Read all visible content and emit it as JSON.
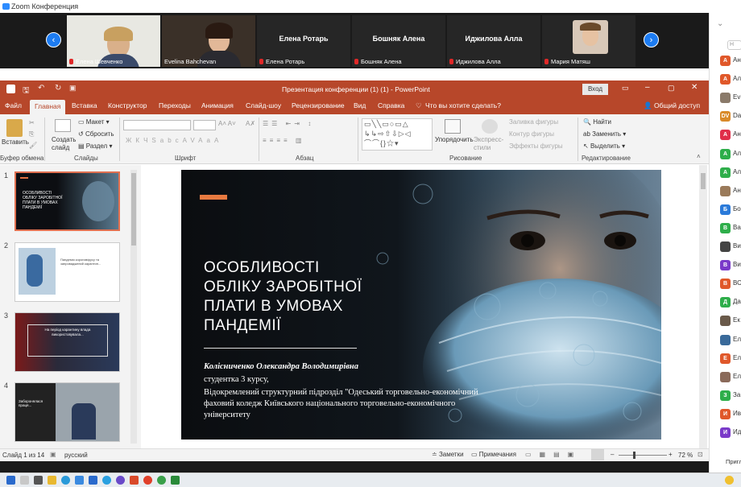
{
  "zoom": {
    "window_title": "Zoom Конференция",
    "participants_tiles": [
      {
        "name": "Елена Шевченко",
        "muted": true,
        "video": true
      },
      {
        "name": "Evelina Bahchevan",
        "muted": false,
        "video": true
      },
      {
        "name": "Елена Ротарь",
        "muted": true,
        "video": false
      },
      {
        "name": "Бошняк Алена",
        "muted": true,
        "video": false
      },
      {
        "name": "Иджилова Алла",
        "muted": true,
        "video": false
      },
      {
        "name": "Мария Матяш",
        "muted": true,
        "video": true
      }
    ],
    "side_list": [
      {
        "initial": "А",
        "color": "#e0582a",
        "name": "Ан"
      },
      {
        "initial": "А",
        "color": "#e0582a",
        "name": "Ал"
      },
      {
        "initial": "",
        "color": "#8a7a6a",
        "name": "Ev"
      },
      {
        "initial": "DV",
        "color": "#d98a2a",
        "name": "Da"
      },
      {
        "initial": "А",
        "color": "#e02e4a",
        "name": "Ан"
      },
      {
        "initial": "А",
        "color": "#2eae4a",
        "name": "Ал"
      },
      {
        "initial": "А",
        "color": "#2eae4a",
        "name": "Ал"
      },
      {
        "initial": "",
        "color": "#9a7a5a",
        "name": "Ан"
      },
      {
        "initial": "Б",
        "color": "#2a7ad9",
        "name": "Бо"
      },
      {
        "initial": "В",
        "color": "#2eae4a",
        "name": "Ва"
      },
      {
        "initial": "",
        "color": "#444",
        "name": "Ви"
      },
      {
        "initial": "В",
        "color": "#7a3ac9",
        "name": "Ви"
      },
      {
        "initial": "В",
        "color": "#e0582a",
        "name": "ВС"
      },
      {
        "initial": "Д",
        "color": "#2eae4a",
        "name": "Да"
      },
      {
        "initial": "",
        "color": "#6a5a4a",
        "name": "Ек"
      },
      {
        "initial": "",
        "color": "#3a6a9a",
        "name": "Ел"
      },
      {
        "initial": "Е",
        "color": "#e0582a",
        "name": "Ел"
      },
      {
        "initial": "",
        "color": "#8a6a5a",
        "name": "Ел"
      },
      {
        "initial": "З",
        "color": "#2eae4a",
        "name": "За"
      },
      {
        "initial": "И",
        "color": "#e0582a",
        "name": "Ив"
      },
      {
        "initial": "И",
        "color": "#7a3ac9",
        "name": "Ид"
      }
    ],
    "invite_label": "Пригл"
  },
  "ppt": {
    "title": "Презентация конференции (1) (1)  -  PowerPoint",
    "login": "Вход",
    "tabs": [
      "Файл",
      "Главная",
      "Вставка",
      "Конструктор",
      "Переходы",
      "Анимация",
      "Слайд-шоу",
      "Рецензирование",
      "Вид",
      "Справка"
    ],
    "tell_me": "Что вы хотите сделать?",
    "share": "Общий доступ",
    "ribbon": {
      "paste": "Вставить",
      "clipboard": "Буфер обмена",
      "new_slide": "Создать слайд",
      "layout": "Макет",
      "reset": "Сбросить",
      "section": "Раздел",
      "slides": "Слайды",
      "font": "Шрифт",
      "font_buttons": [
        "Ж",
        "К",
        "Ч",
        "S",
        "abc",
        "AV",
        "Aa",
        "A"
      ],
      "paragraph": "Абзац",
      "arrange": "Упорядочить",
      "quick_styles": "Экспресс-стили",
      "shape_fill": "Заливка фигуры",
      "shape_outline": "Контур фигуры",
      "shape_effects": "Эффекты фигуры",
      "drawing": "Рисование",
      "find": "Найти",
      "replace": "Заменить",
      "select": "Выделить",
      "editing": "Редактирование"
    },
    "thumbnails": [
      {
        "num": "1",
        "title": "ОСОБЛИВОСТІ ОБЛІКУ ЗАРОБІТНОЇ ПЛАТИ В УМОВАХ ПАНДЕМІЇ"
      },
      {
        "num": "2",
        "text": "Пандемія коронавірусу та запроваджений карантин..."
      },
      {
        "num": "3",
        "text": "На період карантину влада використовувала..."
      },
      {
        "num": "4",
        "text": "Заборонялася праця..."
      }
    ],
    "slide": {
      "title_lines": [
        "ОСОБЛИВОСТІ",
        "ОБЛІКУ ЗАРОБІТНОЇ",
        "ПЛАТИ В УМОВАХ",
        "ПАНДЕМІЇ"
      ],
      "author": "Колісниченко Олександра Володимирівна",
      "course": "студентка 3 курсу,",
      "org": "Відокремлений структурний підрозділ \"Одеський торговельно-економічний фаховий коледж Київського національного торговельно-економічного університету"
    },
    "status": {
      "slide_of": "Слайд 1 из 14",
      "language": "русский",
      "notes": "Заметки",
      "comments": "Примечания",
      "zoom": "72 %"
    }
  }
}
